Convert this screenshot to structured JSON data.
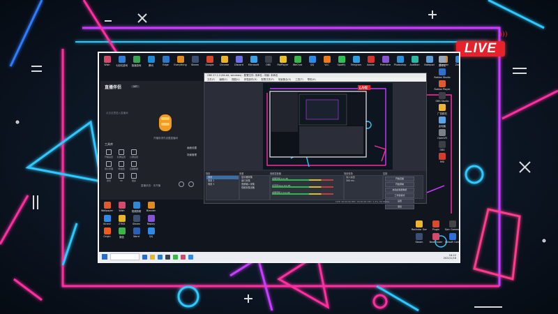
{
  "overlay": {
    "live_label": "LIVE"
  },
  "desktop": {
    "top_icons": [
      {
        "label": "Wish",
        "color": "#d44a6a"
      },
      {
        "label": "七彩虹游戏",
        "color": "#2f7fd6"
      },
      {
        "label": "极速游戏",
        "color": "#3aa655"
      },
      {
        "label": "腾讯",
        "color": "#1d8bd8"
      },
      {
        "label": "Edge",
        "color": "#2a7ac9"
      },
      {
        "label": "Everything",
        "color": "#e08a1f"
      },
      {
        "label": "Steam",
        "color": "#3b4f73"
      },
      {
        "label": "Google",
        "color": "#d9442d"
      },
      {
        "label": "Chrome",
        "color": "#e8b52a"
      },
      {
        "label": "Discord",
        "color": "#6b6fe5"
      },
      {
        "label": "Microsoft",
        "color": "#3aa0e8"
      },
      {
        "label": "OBS",
        "color": "#3b3f48"
      },
      {
        "label": "PotPlayer",
        "color": "#e8c02a"
      },
      {
        "label": "WeChat",
        "color": "#3bb54a"
      },
      {
        "label": "QQ",
        "color": "#2d8ae8"
      },
      {
        "label": "VLC",
        "color": "#ee7a1f"
      },
      {
        "label": "Spotify",
        "color": "#2fbf55"
      },
      {
        "label": "Telegram",
        "color": "#2f9ee0"
      },
      {
        "label": "Adobe",
        "color": "#d8342e"
      },
      {
        "label": "Premiere",
        "color": "#8a53d6"
      },
      {
        "label": "Photoshop",
        "color": "#2c8fd8"
      },
      {
        "label": "Audition",
        "color": "#2bb7a5"
      },
      {
        "label": "Notepad",
        "color": "#5b9fd8"
      },
      {
        "label": "Blender",
        "color": "#e08a1f"
      },
      {
        "label": "Zoom",
        "color": "#2d8ae8"
      },
      {
        "label": "Teams",
        "color": "#6264a7"
      },
      {
        "label": "Nvidia",
        "color": "#6fb92c"
      },
      {
        "label": "Epic",
        "color": "#444"
      },
      {
        "label": "Uplay",
        "color": "#2f6fd6"
      },
      {
        "label": "Origin",
        "color": "#f05a1e"
      }
    ],
    "right_icons": [
      {
        "label": "回收站",
        "color": "#9aa7b8"
      },
      {
        "label": "Roblox Studio",
        "color": "#2e6fd0"
      },
      {
        "label": "Roblox Player",
        "color": "#e05a2e"
      },
      {
        "label": "OBS Studio",
        "color": "#3b3f48"
      },
      {
        "label": "广告精灵",
        "color": "#f0b432"
      },
      {
        "label": "此电脑",
        "color": "#5aa3e8"
      },
      {
        "label": "OpenVR",
        "color": "#7a7f89"
      },
      {
        "label": "OBS",
        "color": "#3b3f48"
      },
      {
        "label": "MSI",
        "color": "#d83a2e"
      }
    ],
    "bottom_icons": [
      {
        "label": "Wallpaper",
        "color": "#e05a2e"
      },
      {
        "label": "Wish",
        "color": "#d44a6a"
      },
      {
        "label": "视频剪辑",
        "color": "#2e8ad6"
      },
      {
        "label": "Blender",
        "color": "#e08a1f"
      },
      {
        "label": "Kinect",
        "color": "#2d8ae8"
      },
      {
        "label": "ZTKD",
        "color": "#e8b52a"
      },
      {
        "label": "Steam",
        "color": "#3b4f73"
      },
      {
        "label": "Replay",
        "color": "#8a53d6"
      },
      {
        "label": "Origin",
        "color": "#f05a1e"
      },
      {
        "label": "微信",
        "color": "#3bb54a"
      },
      {
        "label": "Word",
        "color": "#2b5fb3"
      },
      {
        "label": "QQ",
        "color": "#2d8ae8"
      }
    ],
    "br_icons": [
      {
        "label": "Rockstar Games",
        "color": "#f0b432"
      },
      {
        "label": "Plugin",
        "color": "#d94a2e"
      },
      {
        "label": "Epic Games Launcher",
        "color": "#444"
      },
      {
        "label": "Steam",
        "color": "#3b4f73"
      },
      {
        "label": "Beat Saber",
        "color": "#d44a6a"
      },
      {
        "label": "Ubisoft Connect",
        "color": "#2f6fd6"
      }
    ]
  },
  "recorder": {
    "title": "直播伴侣",
    "badge": "VIP",
    "placeholder": "点击这里进入直播间",
    "tools_title": "工具库",
    "tools": [
      "开播设置",
      "礼物设置",
      "公屏设置",
      "观众管理",
      "粉丝团",
      "直播数据",
      "音乐",
      "PK",
      "更多"
    ],
    "main_label": "开播前请先设置直播间",
    "option_1": "画面设置",
    "option_2": "场景管理",
    "footer": "直播状态：未开播"
  },
  "obs": {
    "title": "OBS 27.1.3 (64-bit, windows) - 配置文件: 未命名 - 场景: 未命名",
    "menu": [
      "文件(F)",
      "编辑(E)",
      "视图(V)",
      "停靠部件(D)",
      "配置文件(P)",
      "场景集合(S)",
      "工具(T)",
      "帮助(H)"
    ],
    "docks": {
      "scenes_title": "场景",
      "sources_title": "来源",
      "mixer_title": "音频混音器",
      "transitions_title": "场景转场",
      "controls_title": "控制"
    },
    "scenes": [
      "场景",
      "场景 2",
      "场景 3"
    ],
    "sources": [
      "显示器采集",
      "窗口采集",
      "音频输入采集",
      "视频采集设备"
    ],
    "mixer": [
      {
        "name": "桌面音频",
        "db": "0.0 dB"
      },
      {
        "name": "麦克风/Aux",
        "db": "0.0 dB"
      },
      {
        "name": "桌面音频 2",
        "db": "0.0 dB"
      }
    ],
    "transition": "淡入淡出",
    "duration": "300 ms",
    "controls": [
      "开始直播",
      "开始录制",
      "启动虚拟摄像机",
      "工作室模式",
      "设置",
      "退出"
    ],
    "status": "LIVE: 00:00:00   REC: 00:00:00   CPU: 1.4%, 60.00 fps"
  },
  "taskbar": {
    "time": "16:22",
    "date": "2022/1/18",
    "apps": [
      "#2b6cc4",
      "#e8b52a",
      "#2a7ac9",
      "#3b3f48",
      "#3bb54a",
      "#d44a6a",
      "#2d8ae8"
    ]
  },
  "colors": {
    "neon_pink": "#ff2da0",
    "neon_blue": "#2dc8ff",
    "neon_purple": "#a040ff",
    "live_red": "#e8222a"
  }
}
